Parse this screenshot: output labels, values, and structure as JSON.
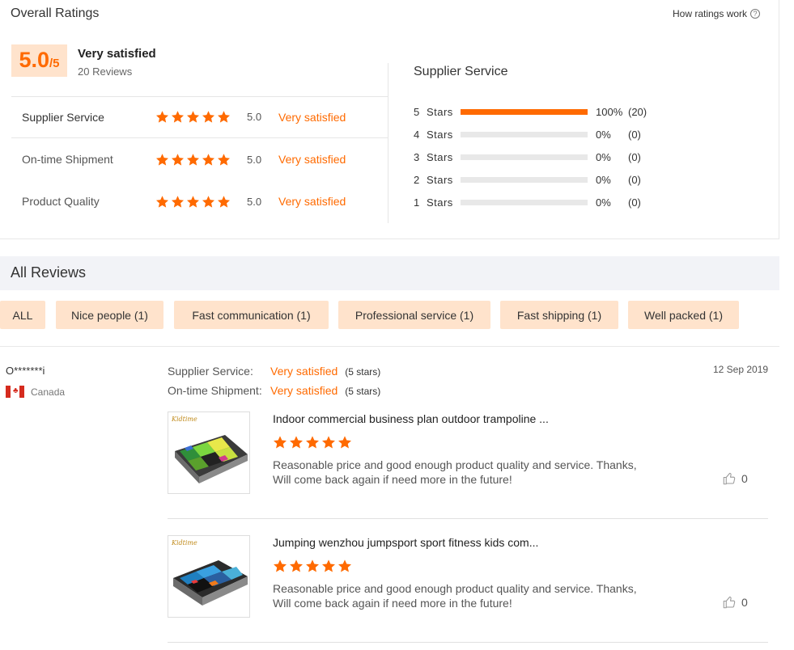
{
  "overall": {
    "title": "Overall Ratings",
    "how_link": "How ratings work",
    "help_symbol": "?",
    "score": "5.0",
    "score_out_of": "/5",
    "satisfaction": "Very satisfied",
    "review_count": "20 Reviews",
    "star_rating": 5,
    "categories": [
      {
        "label": "Supplier Service",
        "score": "5.0",
        "satisfaction": "Very satisfied",
        "stars": 5
      },
      {
        "label": "On-time Shipment",
        "score": "5.0",
        "satisfaction": "Very satisfied",
        "stars": 5
      },
      {
        "label": "Product Quality",
        "score": "5.0",
        "satisfaction": "Very satisfied",
        "stars": 5
      }
    ]
  },
  "distribution": {
    "title": "Supplier Service",
    "rows": [
      {
        "label": "5  Stars",
        "percent": "100%",
        "count": "(20)",
        "fill": 1.0
      },
      {
        "label": "4  Stars",
        "percent": "0%",
        "count": "(0)",
        "fill": 0
      },
      {
        "label": "3  Stars",
        "percent": "0%",
        "count": "(0)",
        "fill": 0
      },
      {
        "label": "2  Stars",
        "percent": "0%",
        "count": "(0)",
        "fill": 0
      },
      {
        "label": "1  Stars",
        "percent": "0%",
        "count": "(0)",
        "fill": 0
      }
    ]
  },
  "all_reviews": {
    "title": "All Reviews",
    "filters": [
      "ALL",
      "Nice people (1)",
      "Fast communication (1)",
      "Professional service (1)",
      "Fast shipping (1)",
      "Well packed (1)"
    ]
  },
  "review": {
    "reviewer": "O*******i",
    "country": "Canada",
    "date": "12 Sep 2019",
    "service_rows": [
      {
        "label": "Supplier Service:",
        "satisfaction": "Very satisfied",
        "stars": "(5 stars)"
      },
      {
        "label": "On-time Shipment:",
        "satisfaction": "Very satisfied",
        "stars": "(5 stars)"
      }
    ],
    "products": [
      {
        "brand": "Kidtime",
        "title": "Indoor commercial business plan outdoor trampoline ...",
        "stars": 5,
        "text": "Reasonable price and good enough product quality and service. Thanks, Will come back again if need more in the future!",
        "likes": "0"
      },
      {
        "brand": "Kidtime",
        "title": "Jumping wenzhou jumpsport sport fitness kids com...",
        "stars": 5,
        "text": "Reasonable price and good enough product quality and service. Thanks, Will come back again if need more in the future!",
        "likes": "0"
      }
    ]
  },
  "colors": {
    "accent": "#ff6a00",
    "chip_bg": "#ffe3cc",
    "header_bg": "#f2f3f7"
  }
}
